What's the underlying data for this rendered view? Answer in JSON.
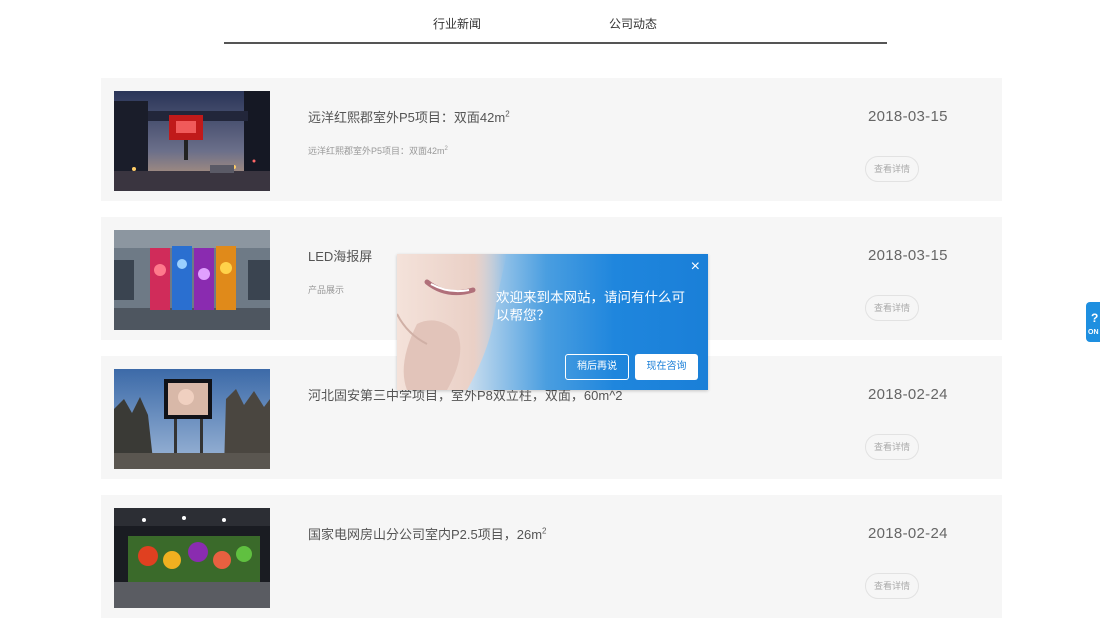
{
  "tabs": [
    {
      "label": "行业新闻"
    },
    {
      "label": "公司动态"
    }
  ],
  "items": [
    {
      "title": "远洋红熙郡室外P5项目：双面42m",
      "title_sup": "2",
      "desc": "远洋红熙郡室外P5项目：双面42m",
      "desc_sup": "2",
      "date": "2018-03-15",
      "button": "查看详情"
    },
    {
      "title": "LED海报屏",
      "title_sup": "",
      "desc": "产品展示",
      "desc_sup": "",
      "date": "2018-03-15",
      "button": "查看详情"
    },
    {
      "title": "河北固安第三中学项目，室外P8双立柱，双面，60m^2",
      "title_sup": "",
      "desc": "",
      "desc_sup": "",
      "date": "2018-02-24",
      "button": "查看详情"
    },
    {
      "title": "国家电网房山分公司室内P2.5项目，26m",
      "title_sup": "2",
      "desc": "",
      "desc_sup": "",
      "date": "2018-02-24",
      "button": "查看详情"
    }
  ],
  "popup": {
    "close": "×",
    "message": "欢迎来到本网站，请问有什么可以帮您？",
    "later_label": "稍后再说",
    "now_label": "现在咨询"
  },
  "side_tab": {
    "icon": "?",
    "label": "ON"
  }
}
